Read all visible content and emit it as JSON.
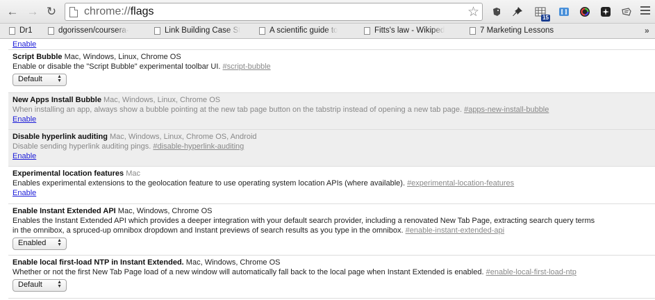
{
  "toolbar": {
    "url_scheme": "chrome://",
    "url_path": "flags"
  },
  "bookmarks": [
    {
      "label": "Dr1"
    },
    {
      "label": "dgorissen/coursera-"
    },
    {
      "label": "Link Building Case St"
    },
    {
      "label": "A scientific guide to"
    },
    {
      "label": "Fitts's law - Wikiped"
    },
    {
      "label": "7 Marketing Lessons"
    }
  ],
  "extensions": {
    "badge_count": "15"
  },
  "flags": [
    {
      "enable_label": "Enable"
    },
    {
      "title": "Script Bubble",
      "platforms": "Mac, Windows, Linux, Chrome OS",
      "description": "Enable or disable the \"Script Bubble\" experimental toolbar UI.",
      "anchor": "#script-bubble",
      "select_value": "Default"
    },
    {
      "title": "New Apps Install Bubble",
      "platforms": "Mac, Windows, Linux, Chrome OS",
      "description": "When installing an app, always show a bubble pointing at the new tab page button on the tabstrip instead of opening a new tab page.",
      "anchor": "#apps-new-install-bubble",
      "enable_label": "Enable"
    },
    {
      "title": "Disable hyperlink auditing",
      "platforms": "Mac, Windows, Linux, Chrome OS, Android",
      "description": "Disable sending hyperlink auditing pings.",
      "anchor": "#disable-hyperlink-auditing",
      "enable_label": "Enable"
    },
    {
      "title": "Experimental location features",
      "platforms": "Mac",
      "description": "Enables experimental extensions to the geolocation feature to use operating system location APIs (where available).",
      "anchor": "#experimental-location-features",
      "enable_label": "Enable"
    },
    {
      "title": "Enable Instant Extended API",
      "platforms": "Mac, Windows, Chrome OS",
      "description_line1": "Enables the Instant Extended API which provides a deeper integration with your default search provider, including a renovated New Tab Page, extracting search query terms",
      "description_line2": "in the omnibox, a spruced-up omnibox dropdown and Instant previews of search results as you type in the omnibox.",
      "anchor": "#enable-instant-extended-api",
      "select_value": "Enabled"
    },
    {
      "title": "Enable local first-load NTP in Instant Extended.",
      "platforms": "Mac, Windows, Chrome OS",
      "description": "Whether or not the first New Tab Page load of a new window will automatically fall back to the local page when Instant Extended is enabled.",
      "anchor": "#enable-local-first-load-ntp",
      "select_value": "Default"
    }
  ]
}
